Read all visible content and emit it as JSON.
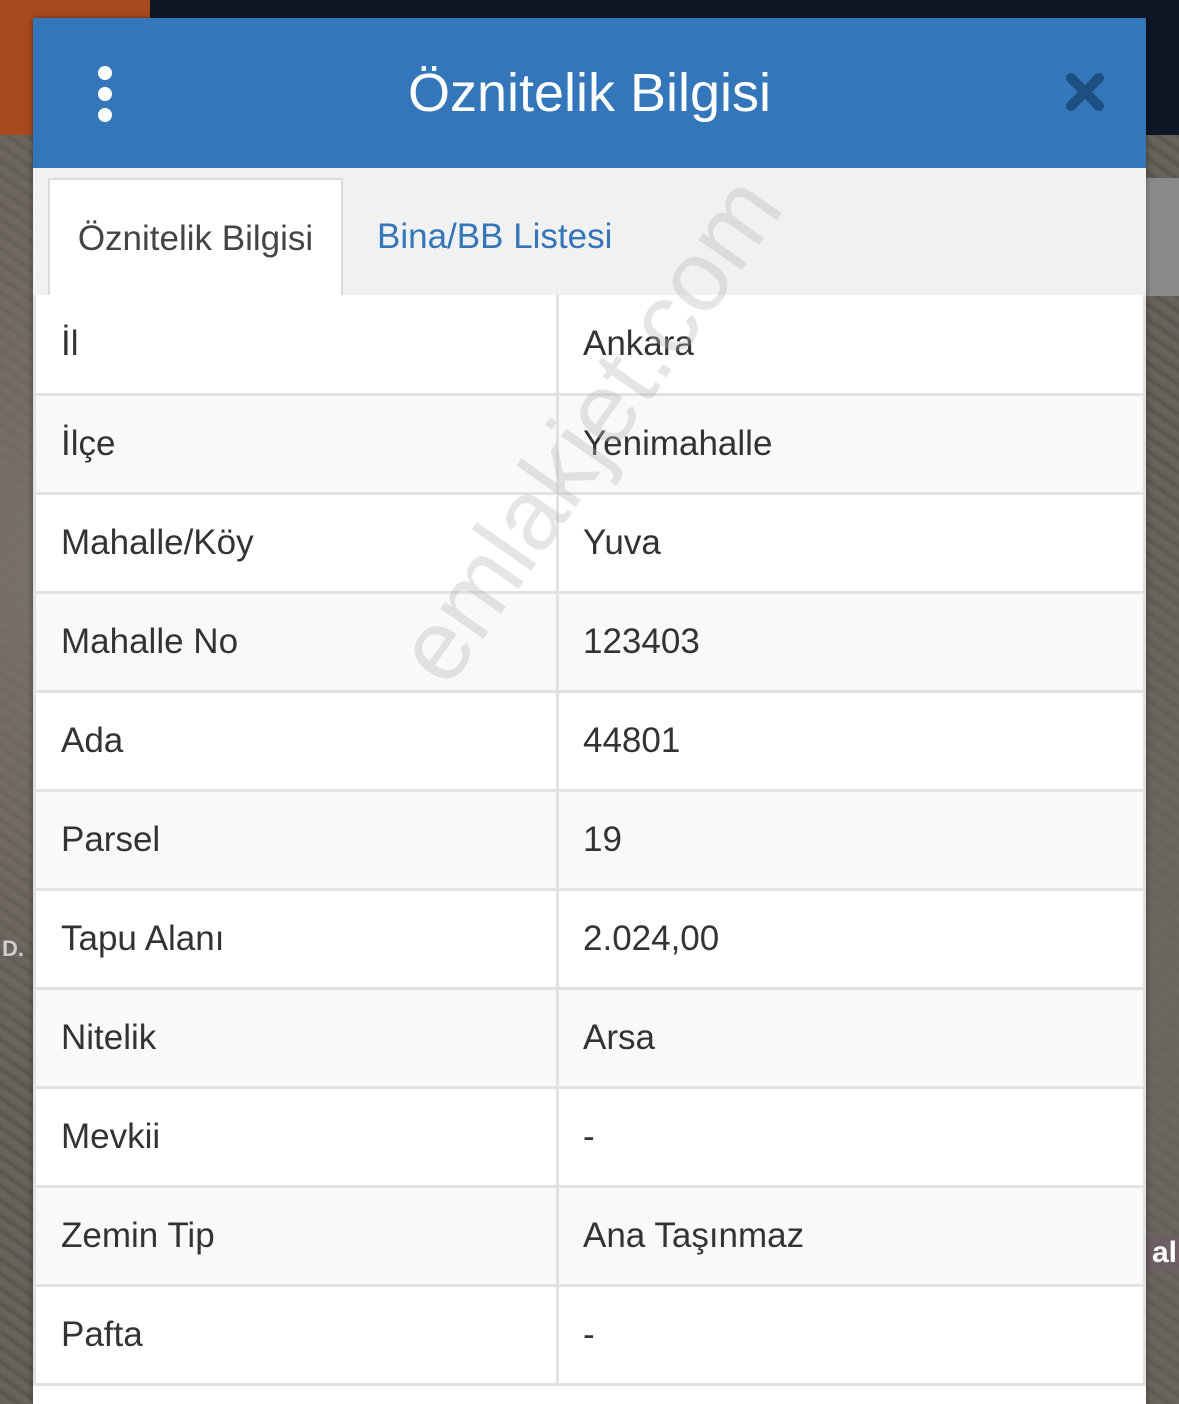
{
  "map": {
    "label_left": "D.",
    "label_right": "al"
  },
  "dialog": {
    "title": "Öznitelik Bilgisi",
    "menu_icon": "kebab-menu-icon",
    "close_icon": "close-icon",
    "tabs": [
      {
        "label": "Öznitelik Bilgisi",
        "active": true
      },
      {
        "label": "Bina/BB Listesi",
        "active": false
      }
    ],
    "rows": [
      {
        "key": "İl",
        "value": "Ankara"
      },
      {
        "key": "İlçe",
        "value": "Yenimahalle"
      },
      {
        "key": "Mahalle/Köy",
        "value": "Yuva"
      },
      {
        "key": "Mahalle No",
        "value": "123403"
      },
      {
        "key": "Ada",
        "value": "44801"
      },
      {
        "key": "Parsel",
        "value": "19"
      },
      {
        "key": "Tapu Alanı",
        "value": "2.024,00"
      },
      {
        "key": "Nitelik",
        "value": "Arsa"
      },
      {
        "key": "Mevkii",
        "value": "-"
      },
      {
        "key": "Zemin Tip",
        "value": "Ana Taşınmaz"
      },
      {
        "key": "Pafta",
        "value": "-"
      }
    ],
    "watermark": "emlakjet.com"
  },
  "colors": {
    "header": "#3376ba",
    "tab_link": "#3376ba"
  }
}
